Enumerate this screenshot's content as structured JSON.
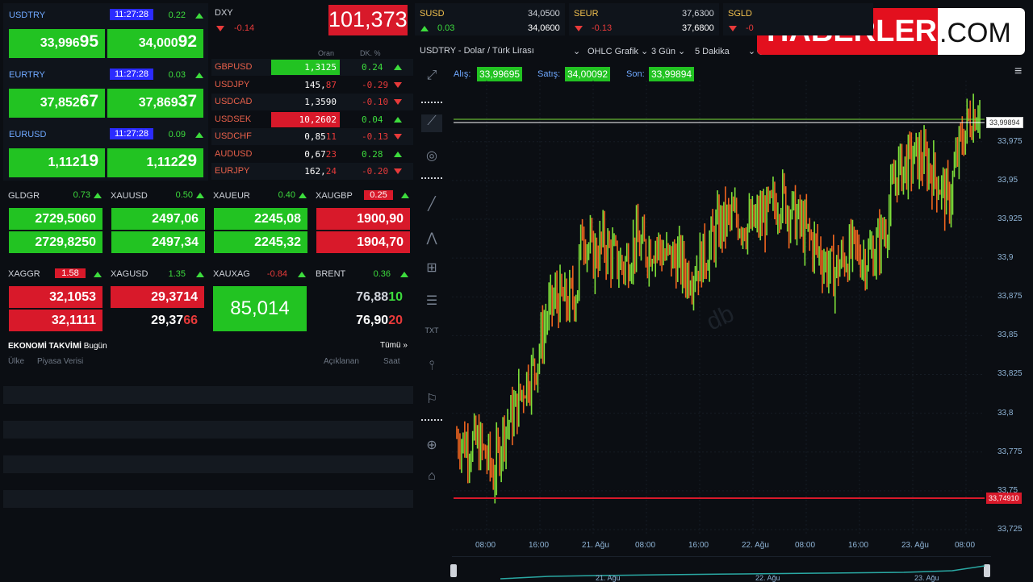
{
  "majors": [
    {
      "sym": "USDTRY",
      "time": "11:27:28",
      "chg": "0.22",
      "bid_main": "33,996",
      "bid_big": "95",
      "ask_main": "34,000",
      "ask_big": "92"
    },
    {
      "sym": "EURTRY",
      "time": "11:27:28",
      "chg": "0.03",
      "bid_main": "37,852",
      "bid_big": "67",
      "ask_main": "37,869",
      "ask_big": "37"
    },
    {
      "sym": "EURUSD",
      "time": "11:27:28",
      "chg": "0.09",
      "bid_main": "1,112",
      "bid_big": "19",
      "ask_main": "1,112",
      "ask_big": "29"
    }
  ],
  "dxy": {
    "label": "DXY",
    "chg": "-0.14",
    "value": "101,373"
  },
  "fx_header": {
    "rate": "Oran",
    "chg": "DK. %"
  },
  "fx": [
    {
      "sym": "GBPUSD",
      "rate_main": "1,3125",
      "rate_tail": "",
      "chg": "0.24",
      "dir": "up",
      "hl": "green"
    },
    {
      "sym": "USDJPY",
      "rate_main": "145,",
      "rate_tail": "87",
      "chg": "-0.29",
      "dir": "dn",
      "hl": ""
    },
    {
      "sym": "USDCAD",
      "rate_main": "1,3590",
      "rate_tail": "",
      "chg": "-0.10",
      "dir": "dn",
      "hl": ""
    },
    {
      "sym": "USDSEK",
      "rate_main": "10,2602",
      "rate_tail": "",
      "chg": "0.04",
      "dir": "up",
      "hl": "red"
    },
    {
      "sym": "USDCHF",
      "rate_main": "0,85",
      "rate_tail": "11",
      "chg": "-0.13",
      "dir": "dn",
      "hl": ""
    },
    {
      "sym": "AUDUSD",
      "rate_main": "0,67",
      "rate_tail": "23",
      "chg": "0.28",
      "dir": "up",
      "hl": ""
    },
    {
      "sym": "EURJPY",
      "rate_main": "162,",
      "rate_tail": "24",
      "chg": "-0.20",
      "dir": "dn",
      "hl": ""
    }
  ],
  "metals1": [
    {
      "sym": "GLDGR",
      "chg": "0.73",
      "bid": "2729,5060",
      "ask": "2729,8250",
      "color": "green"
    },
    {
      "sym": "XAUUSD",
      "chg": "0.50",
      "bid": "2497,06",
      "ask": "2497,34",
      "color": "green"
    },
    {
      "sym": "XAUEUR",
      "chg": "0.40",
      "bid": "2245,08",
      "ask": "2245,32",
      "color": "green"
    },
    {
      "sym": "XAUGBP",
      "chg": "0.25",
      "bid": "1900,90",
      "ask": "1904,70",
      "color": "red"
    }
  ],
  "metals2": {
    "xaggr": {
      "sym": "XAGGR",
      "chg": "1.58",
      "bid": "32,1053",
      "ask": "32,1111"
    },
    "xagusd": {
      "sym": "XAGUSD",
      "chg": "1.35",
      "bid": "29,3714",
      "ask_main": "29,37",
      "ask_tail": "66"
    },
    "xauxag": {
      "sym": "XAUXAG",
      "chg": "-0.84",
      "value": "85,014"
    },
    "brent": {
      "sym": "BRENT",
      "chg": "0.36",
      "bid_main": "76,88",
      "bid_tail": "10",
      "ask_main": "76,90",
      "ask_tail": "20"
    }
  },
  "calendar": {
    "title": "EKONOMİ TAKVİMİ",
    "today": "Bugün",
    "all": "Tümü »",
    "cols": [
      "Ülke",
      "Piyasa Verisi",
      "Açıklanan",
      "Saat"
    ]
  },
  "topbar": [
    {
      "sym": "SUSD",
      "chg": "0.03",
      "v1": "34,0500",
      "v2": "34,0600",
      "dir": "up"
    },
    {
      "sym": "SEUR",
      "chg": "-0.13",
      "v1": "37,6300",
      "v2": "37,6800",
      "dir": "dn"
    },
    {
      "sym": "SGLD",
      "chg": "-0",
      "v1": "",
      "v2": "",
      "dir": "dn"
    }
  ],
  "chart_toolbar": {
    "instrument": "USDTRY - Dolar / Türk Lirası",
    "type": "OHLC Grafik",
    "range": "3 Gün",
    "interval": "5 Dakika"
  },
  "quote_line": {
    "bid_label": "Alış:",
    "bid": "33,99695",
    "ask_label": "Satış:",
    "ask": "34,00092",
    "last_label": "Son:",
    "last": "33,99894"
  },
  "logo": {
    "main": "HABERLER",
    "suffix": ".COM"
  },
  "watermark": "db",
  "chart_data": {
    "type": "ohlc",
    "ylim": [
      33.725,
      33.995
    ],
    "yticks": [
      "33,975",
      "33,95",
      "33,925",
      "33,9",
      "33,875",
      "33,85",
      "33,825",
      "33,8",
      "33,775",
      "33,75",
      "33,725"
    ],
    "xticks": [
      "08:00",
      "16:00",
      "21. Ağu",
      "08:00",
      "16:00",
      "22. Ağu",
      "08:00",
      "16:00",
      "23. Ağu",
      "08:00"
    ],
    "price_label": "33,99894",
    "low_label": "33,74910",
    "navigator_labels": [
      "21. Ağu",
      "22. Ağu",
      "23. Ağu"
    ],
    "path": [
      [
        0,
        33.785
      ],
      [
        0.02,
        33.78
      ],
      [
        0.04,
        33.78
      ],
      [
        0.06,
        33.77
      ],
      [
        0.07,
        33.76
      ],
      [
        0.09,
        33.79
      ],
      [
        0.11,
        33.8
      ],
      [
        0.13,
        33.82
      ],
      [
        0.15,
        33.83
      ],
      [
        0.17,
        33.86
      ],
      [
        0.19,
        33.875
      ],
      [
        0.21,
        33.87
      ],
      [
        0.23,
        33.88
      ],
      [
        0.24,
        33.92
      ],
      [
        0.26,
        33.9
      ],
      [
        0.28,
        33.91
      ],
      [
        0.3,
        33.9
      ],
      [
        0.32,
        33.895
      ],
      [
        0.34,
        33.91
      ],
      [
        0.36,
        33.905
      ],
      [
        0.38,
        33.91
      ],
      [
        0.4,
        33.9
      ],
      [
        0.42,
        33.9
      ],
      [
        0.44,
        33.89
      ],
      [
        0.46,
        33.895
      ],
      [
        0.48,
        33.905
      ],
      [
        0.5,
        33.92
      ],
      [
        0.52,
        33.925
      ],
      [
        0.54,
        33.925
      ],
      [
        0.56,
        33.92
      ],
      [
        0.58,
        33.925
      ],
      [
        0.6,
        33.93
      ],
      [
        0.62,
        33.94
      ],
      [
        0.64,
        33.93
      ],
      [
        0.66,
        33.92
      ],
      [
        0.68,
        33.91
      ],
      [
        0.7,
        33.9
      ],
      [
        0.72,
        33.89
      ],
      [
        0.74,
        33.9
      ],
      [
        0.76,
        33.905
      ],
      [
        0.78,
        33.9
      ],
      [
        0.8,
        33.905
      ],
      [
        0.82,
        33.92
      ],
      [
        0.84,
        33.955
      ],
      [
        0.86,
        33.96
      ],
      [
        0.88,
        33.965
      ],
      [
        0.9,
        33.96
      ],
      [
        0.92,
        33.95
      ],
      [
        0.94,
        33.935
      ],
      [
        0.96,
        33.97
      ],
      [
        0.98,
        33.99
      ],
      [
        1.0,
        33.999
      ]
    ]
  }
}
